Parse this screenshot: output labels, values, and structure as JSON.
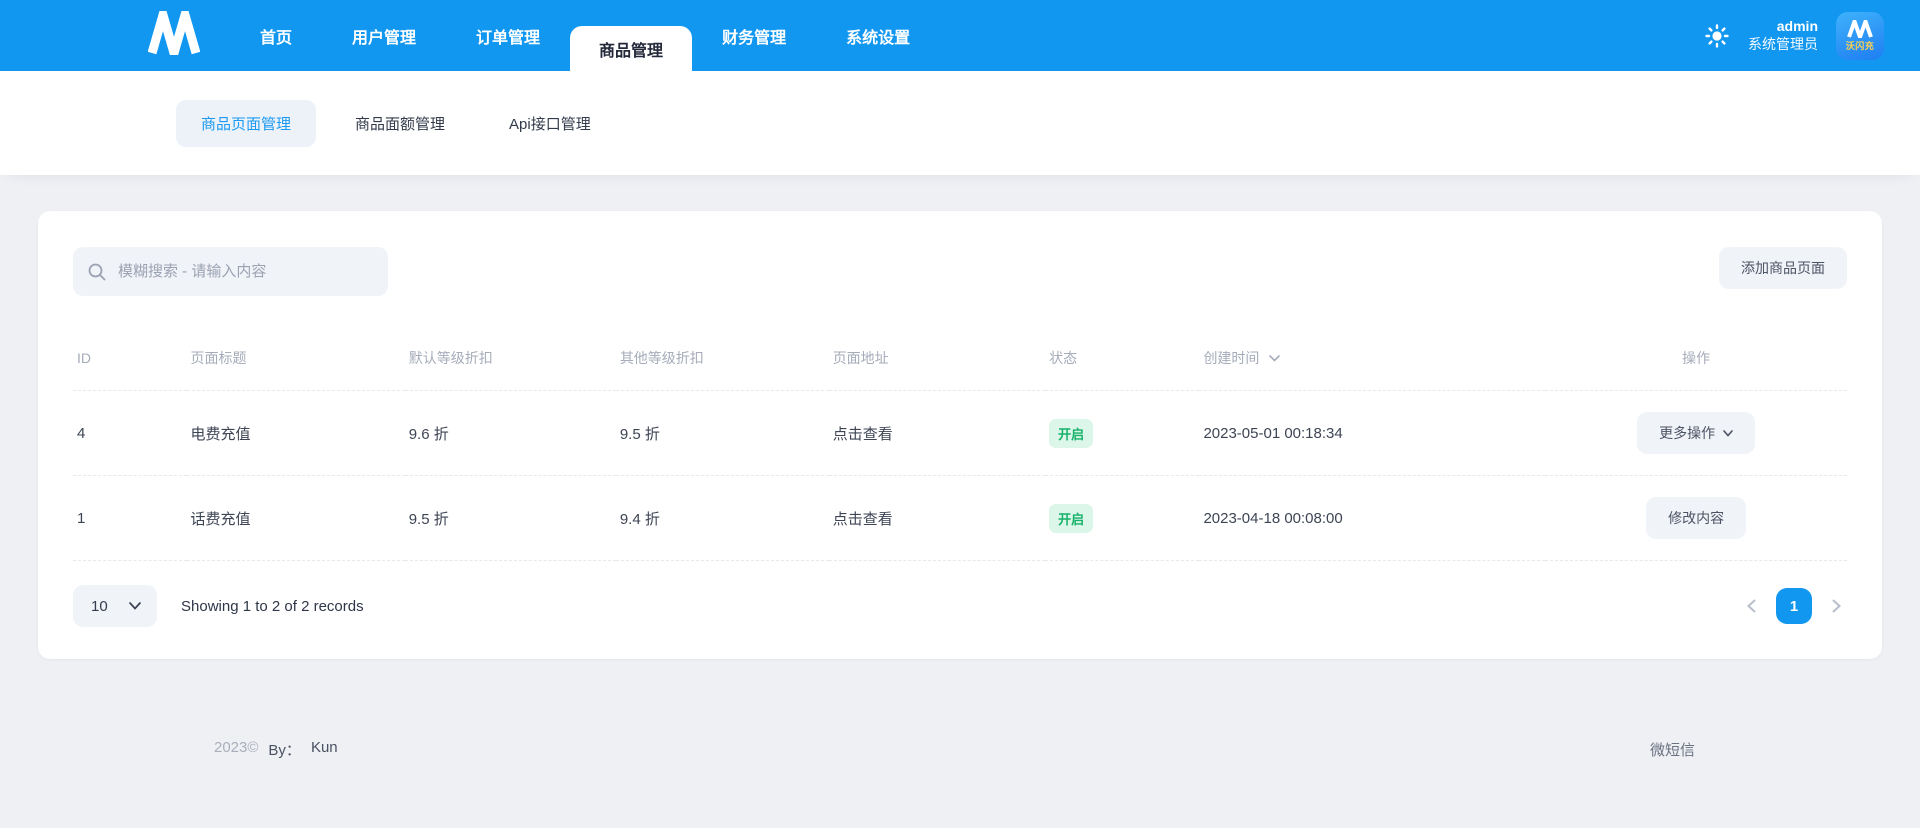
{
  "colors": {
    "accent_blue": "#1297f0",
    "success_green": "#17b26a",
    "success_bg": "#dcf6e9",
    "page_bg": "#eef0f4"
  },
  "header": {
    "nav": [
      {
        "label": "首页"
      },
      {
        "label": "用户管理"
      },
      {
        "label": "订单管理"
      },
      {
        "label": "商品管理"
      },
      {
        "label": "财务管理"
      },
      {
        "label": "系统设置"
      }
    ],
    "active_nav": "商品管理",
    "user": {
      "name": "admin",
      "role": "系统管理员"
    },
    "avatar_text": "沃闪充"
  },
  "subnav": {
    "tabs": [
      {
        "label": "商品页面管理"
      },
      {
        "label": "商品面额管理"
      },
      {
        "label": "Api接口管理"
      }
    ],
    "active_tab": "商品页面管理"
  },
  "toolbar": {
    "search_placeholder": "模糊搜索 - 请输入内容",
    "add_button": "添加商品页面"
  },
  "table": {
    "columns": {
      "id": "ID",
      "title": "页面标题",
      "default_discount": "默认等级折扣",
      "other_discount": "其他等级折扣",
      "page_link": "页面地址",
      "status": "状态",
      "created_at": "创建时间",
      "action": "操作"
    },
    "rows": [
      {
        "id": "4",
        "title": "电费充值",
        "default_discount": "9.6 折",
        "other_discount": "9.5 折",
        "page_link": "点击查看",
        "status": "开启",
        "created_at": "2023-05-01 00:18:34",
        "action": "更多操作"
      },
      {
        "id": "1",
        "title": "话费充值",
        "default_discount": "9.5 折",
        "other_discount": "9.4 折",
        "page_link": "点击查看",
        "status": "开启",
        "created_at": "2023-04-18 00:08:00",
        "action": "修改内容"
      }
    ]
  },
  "pagination": {
    "page_size": "10",
    "summary": "Showing 1 to 2 of 2 records",
    "current_page": "1"
  },
  "footer": {
    "year": "2023©",
    "by_label": "By：",
    "author": "Kun",
    "right_text": "微短信"
  }
}
